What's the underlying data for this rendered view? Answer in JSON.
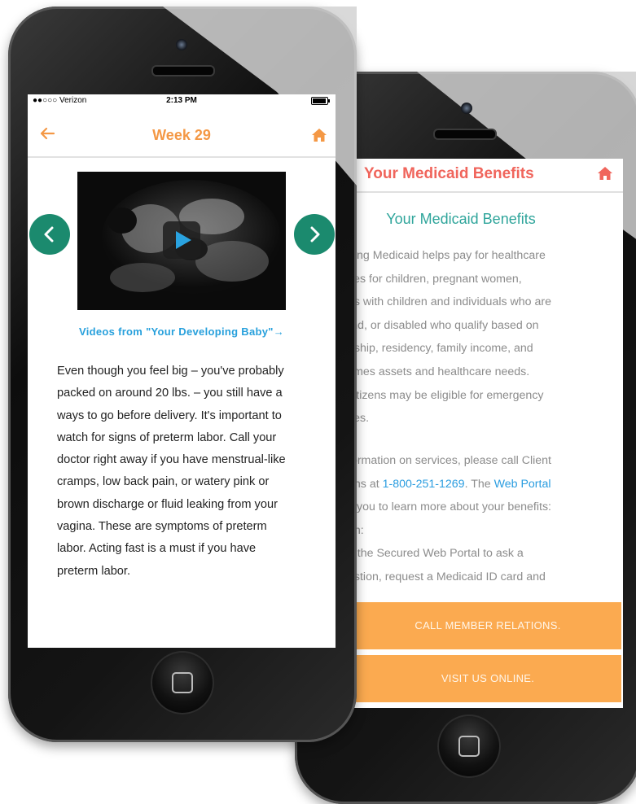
{
  "back_phone": {
    "nav_title": "Your Medicaid Benefits",
    "home_icon": "home-icon",
    "heading": "Your Medicaid Benefits",
    "paragraph1_lines": [
      "ning Medicaid helps pay for healthcare",
      "ces for children, pregnant women,",
      "es with children and individuals who are",
      "blind, or disabled who qualify based on",
      "nship, residency, family income, and",
      "times assets and healthcare needs.",
      "citizens may be eligible for emergency",
      "ces."
    ],
    "paragraph2": {
      "line1": "formation on services, please call Client",
      "line2_prefix": "ons at ",
      "phone_link": "1-800-251-1269",
      "line2_mid": ". The ",
      "portal_link": "Web Portal",
      "line3": "s you to learn more about your benefits:",
      "line4": "an:",
      "line5": "to the Secured Web Portal to ask a",
      "line6": "estion, request a Medicaid ID card and"
    },
    "buttons": {
      "call": "CALL MEMBER RELATIONS.",
      "visit": "VISIT US ONLINE."
    },
    "colors": {
      "title": "#f0655c",
      "heading": "#2fa59b",
      "button": "#fbaa50",
      "link": "#2a9de0"
    }
  },
  "front_phone": {
    "status_bar": {
      "carrier": "●●○○○ Verizon",
      "time": "2:13 PM"
    },
    "nav_title": "Week 29",
    "back_icon": "arrow-left-icon",
    "home_icon": "home-icon",
    "video_caption": "Videos from \"Your Developing Baby\"→",
    "body_lines": [
      "Even though you feel big – you've probably",
      "packed on around 20 lbs. – you still have a",
      "ways to go before delivery. It's important to",
      "watch for signs of preterm labor. Call your",
      "doctor right away if you have menstrual-like",
      "cramps, low back pain, or watery pink or",
      "brown discharge or fluid leaking from your",
      "vagina. These are symptoms of preterm",
      "labor. Acting fast is a must if you have",
      "preterm labor."
    ],
    "colors": {
      "title": "#f49845",
      "arrows": "#1b8a6e",
      "caption": "#27a0dc",
      "play": "#2aa3e0"
    }
  }
}
